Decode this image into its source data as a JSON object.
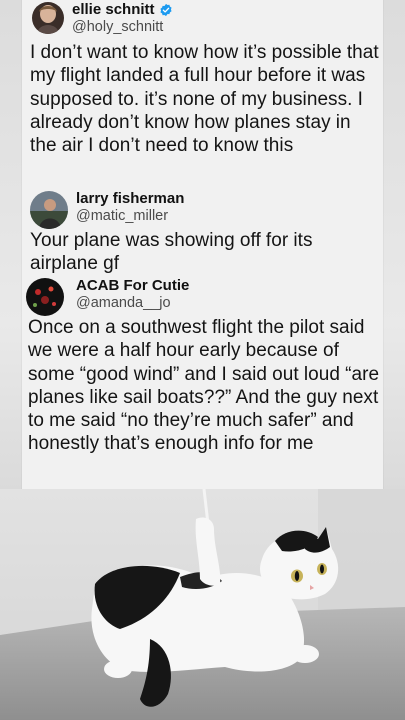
{
  "tweets": [
    {
      "display_name": "ellie schnitt",
      "handle": "@holy_schnitt",
      "verified": true,
      "avatar_icon": "woman-portrait-avatar",
      "text": "I don’t want to know how it’s possible that my flight landed a full hour before it was supposed to. it’s none of my business. I already don’t know how planes stay in the air I don’t need to know this"
    },
    {
      "display_name": "larry fisherman",
      "handle": "@matic_miller",
      "verified": false,
      "avatar_icon": "person-outdoors-avatar",
      "text": "Your plane was showing off for its airplane gf"
    },
    {
      "display_name": "ACAB For Cutie",
      "handle": "@amanda__jo",
      "verified": false,
      "avatar_icon": "red-lights-avatar",
      "text": "Once on a southwest flight the pilot said we were a half hour early because of some “good wind” and I said out loud “are planes like sail boats??” And the guy next to me said “no they’re much safer” and honestly that’s enough info for me"
    }
  ],
  "photo": {
    "subject": "cat-photo",
    "colors": {
      "wall": "#e6e6e6",
      "sofa": "#a9a9a9",
      "cat_black": "#161616",
      "cat_white": "#f7f7f7",
      "eye": "#c7b35a"
    }
  },
  "colors": {
    "card_bg": "#f1f1f1",
    "text": "#141414",
    "handle": "#4b4b4b",
    "verified": "#1d9bf0"
  }
}
